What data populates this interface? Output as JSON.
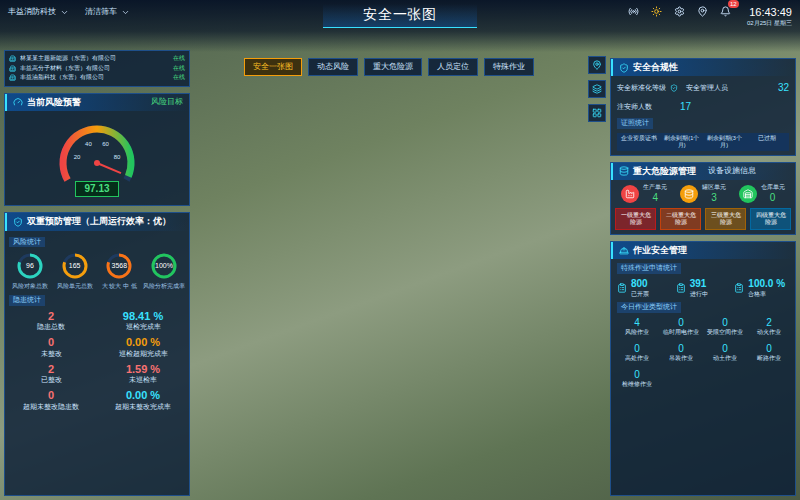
{
  "header": {
    "company": "丰益消防科技",
    "workshop": "清洁筛车",
    "title": "安全一张图",
    "badge": "12",
    "time": "16:43:49",
    "date": "02月25日",
    "weekday": "星期三"
  },
  "tabs": [
    {
      "label": "安全一张图",
      "selected": true
    },
    {
      "label": "动态风险",
      "selected": false
    },
    {
      "label": "重大危险源",
      "selected": false
    },
    {
      "label": "人员定位",
      "selected": false
    },
    {
      "label": "特殊作业",
      "selected": false
    }
  ],
  "companies": [
    {
      "name": "林某某主题新能源（东营）有限公司",
      "status": "在线"
    },
    {
      "name": "丰益高分子材料（东营）有限公司",
      "status": "在线"
    },
    {
      "name": "丰益油脂科技（东营）有限公司",
      "status": "在线"
    }
  ],
  "risk_warning": {
    "title": "当前风险预警",
    "link": "风险目标",
    "ticks": [
      "20",
      "40",
      "60",
      "80"
    ],
    "value": "97.13",
    "level": 0.97
  },
  "prevention": {
    "title": "双重预防管理（上周运行效率：优）",
    "risk_title": "风险统计",
    "risk_stats": [
      {
        "value": "96",
        "label": "风险对象总数",
        "color": "#2dd4bf",
        "level": 0.8
      },
      {
        "value": "165",
        "label": "风险单元总数",
        "color": "#f59e0b",
        "level": 0.8
      },
      {
        "value": "3568",
        "label": "大 较大 中 低",
        "color": "#f97316",
        "level": 0.8
      },
      {
        "value": "100%",
        "label": "风险分析完成率",
        "color": "#22c55e",
        "level": 1
      }
    ],
    "hazard_title": "隐患统计",
    "hazard_stats": [
      {
        "value": "2",
        "label": "隐患总数",
        "color": "#f87171"
      },
      {
        "value": "98.41 %",
        "label": "巡检完成率",
        "color": "#38e1ff"
      },
      {
        "value": "0",
        "label": "未整改",
        "color": "#f87171"
      },
      {
        "value": "0.00 %",
        "label": "巡检超期完成率",
        "color": "#f59e0b"
      },
      {
        "value": "2",
        "label": "已整改",
        "color": "#f87171"
      },
      {
        "value": "1.59 %",
        "label": "未巡检率",
        "color": "#f87171"
      },
      {
        "value": "0",
        "label": "超期未整改隐患数",
        "color": "#f87171"
      },
      {
        "value": "0.00 %",
        "label": "超期未整改完成率",
        "color": "#38e1ff"
      }
    ]
  },
  "compliance": {
    "title": "安全合规性",
    "level_label": "安全标准化等级",
    "staff": [
      {
        "label": "安全管理人员",
        "value": "32"
      },
      {
        "label": "注安师人数",
        "value": "17"
      }
    ],
    "license_title": "证照统计",
    "license_columns": [
      "企业资质证书",
      "剩余到期(1个月)",
      "剩余到期(3个月)",
      "已过期"
    ]
  },
  "hazard_source": {
    "title": "重大危险源管理",
    "subtitle": "设备设施信息",
    "units": [
      {
        "label": "生产单元",
        "value": "4",
        "color": "#ef4444"
      },
      {
        "label": "罐区单元",
        "value": "3",
        "color": "#f59e0b"
      },
      {
        "label": "仓库单元",
        "value": "0",
        "color": "#22c55e"
      }
    ],
    "levels": [
      {
        "label": "一级重大危险源",
        "color": "#b91c1c"
      },
      {
        "label": "二级重大危险源",
        "color": "#c2410c"
      },
      {
        "label": "三级重大危险源",
        "color": "#a16207"
      },
      {
        "label": "四级重大危险源",
        "color": "#0369a1"
      }
    ]
  },
  "work": {
    "title": "作业安全管理",
    "subtitle": "特殊作业申请统计",
    "summary": [
      {
        "value": "800",
        "label": "已开票"
      },
      {
        "value": "391",
        "label": "进行中"
      },
      {
        "value": "100.0 %",
        "label": "合格率"
      }
    ],
    "type_title": "今日作业类型统计",
    "types": [
      {
        "value": "4",
        "label": "风险作业"
      },
      {
        "value": "0",
        "label": "临时用电作业"
      },
      {
        "value": "0",
        "label": "受限空间作业"
      },
      {
        "value": "2",
        "label": "动火作业"
      },
      {
        "value": "0",
        "label": "高处作业"
      },
      {
        "value": "0",
        "label": "吊装作业"
      },
      {
        "value": "0",
        "label": "动土作业"
      },
      {
        "value": "0",
        "label": "断路作业"
      },
      {
        "value": "0",
        "label": "检维修作业"
      }
    ]
  }
}
